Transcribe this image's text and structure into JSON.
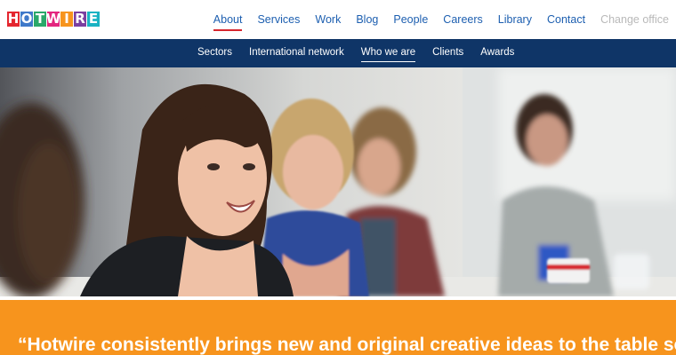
{
  "header": {
    "logo": {
      "text": "HOTWIRE",
      "letters": [
        {
          "char": "H",
          "color": "#e4262f"
        },
        {
          "char": "O",
          "color": "#3f79c9"
        },
        {
          "char": "T",
          "color": "#2aa86a"
        },
        {
          "char": "W",
          "color": "#e3267f"
        },
        {
          "char": "I",
          "color": "#f7941d"
        },
        {
          "char": "R",
          "color": "#7b3fa0"
        },
        {
          "char": "E",
          "color": "#1ab3c3"
        }
      ]
    },
    "nav": [
      {
        "label": "About",
        "active": true
      },
      {
        "label": "Services",
        "active": false
      },
      {
        "label": "Work",
        "active": false
      },
      {
        "label": "Blog",
        "active": false
      },
      {
        "label": "People",
        "active": false
      },
      {
        "label": "Careers",
        "active": false
      },
      {
        "label": "Library",
        "active": false
      },
      {
        "label": "Contact",
        "active": false
      },
      {
        "label": "Change office",
        "active": false
      }
    ]
  },
  "subnav": {
    "items": [
      {
        "label": "Sectors",
        "active": false
      },
      {
        "label": "International network",
        "active": false
      },
      {
        "label": "Who we are",
        "active": true
      },
      {
        "label": "Clients",
        "active": false
      },
      {
        "label": "Awards",
        "active": false
      }
    ]
  },
  "hero": {
    "image": "team-meeting-photo"
  },
  "quote": {
    "text": "“Hotwire consistently brings new and original creative ideas to the table so"
  },
  "colors": {
    "nav_link": "#1d5fb0",
    "active_underline": "#d7262e",
    "subnav_bg": "#0f3567",
    "quote_bg": "#f7941d"
  }
}
